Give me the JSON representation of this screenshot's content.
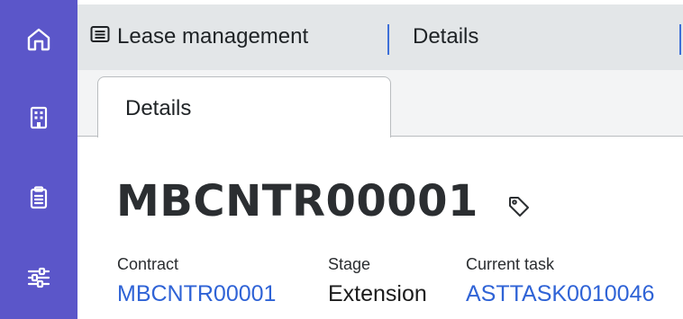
{
  "sidebar": {
    "items": [
      {
        "icon": "home-icon"
      },
      {
        "icon": "building-icon"
      },
      {
        "icon": "clipboard-icon"
      },
      {
        "icon": "sliders-icon"
      }
    ]
  },
  "breadcrumb": {
    "lease_label": "Lease management",
    "details_label": "Details"
  },
  "tabs": [
    {
      "label": "Details",
      "active": true
    }
  ],
  "record": {
    "title": "MBCNTR00001"
  },
  "fields": {
    "contract": {
      "label": "Contract",
      "value": "MBCNTR00001"
    },
    "stage": {
      "label": "Stage",
      "value": "Extension"
    },
    "current_task": {
      "label": "Current task",
      "value": "ASTTASK0010046"
    }
  },
  "colors": {
    "sidebar": "#5b56c9",
    "link": "#2f63d6",
    "accent_separator": "#3d6fd8"
  }
}
